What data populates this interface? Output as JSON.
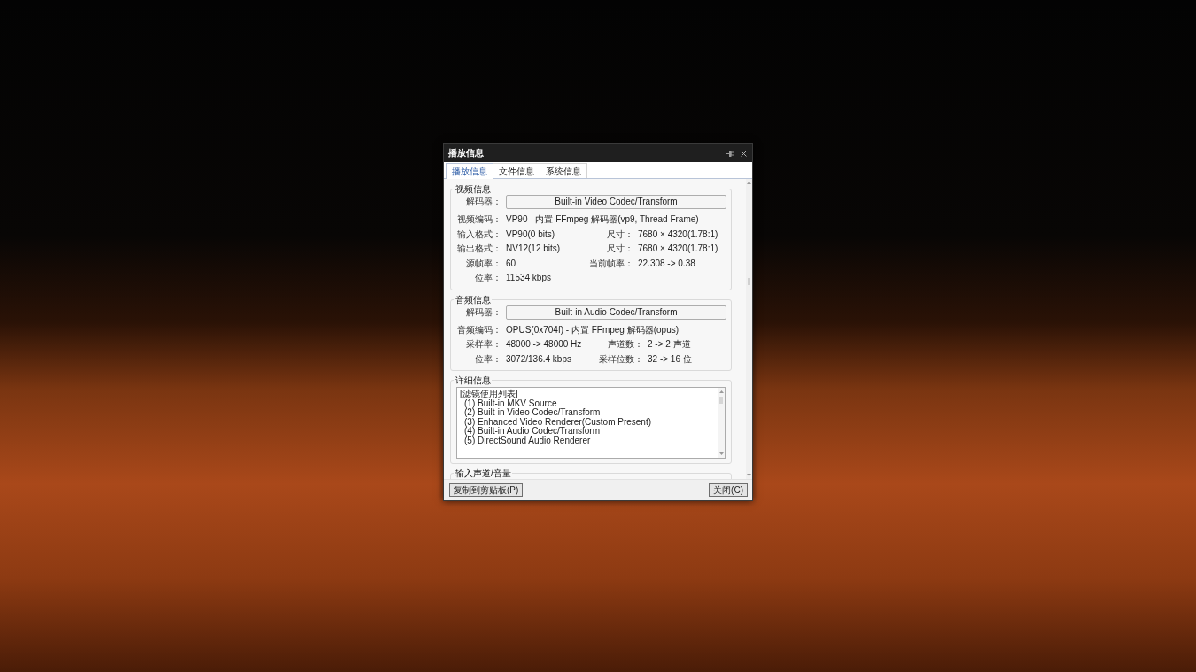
{
  "window": {
    "title": "播放信息"
  },
  "tabs": [
    {
      "label": "播放信息",
      "selected": true
    },
    {
      "label": "文件信息",
      "selected": false
    },
    {
      "label": "系统信息",
      "selected": false
    }
  ],
  "sections": [
    {
      "kind": "info",
      "title": "视频信息",
      "decoder": {
        "label": "解码器：",
        "value": "Built-in Video Codec/Transform"
      },
      "rows": [
        {
          "fields": [
            {
              "label": "视频编码：",
              "value": "VP90 - 内置 FFmpeg 解码器(vp9, Thread Frame)"
            }
          ]
        },
        {
          "fields": [
            {
              "label": "输入格式：",
              "value": "VP90(0 bits)"
            },
            {
              "label": "尺寸：",
              "value": "7680 × 4320(1.78:1)"
            }
          ]
        },
        {
          "fields": [
            {
              "label": "输出格式：",
              "value": "NV12(12 bits)"
            },
            {
              "label": "尺寸：",
              "value": "7680 × 4320(1.78:1)"
            }
          ]
        },
        {
          "fields": [
            {
              "label": "源帧率：",
              "value": "60"
            },
            {
              "label": "当前帧率：",
              "value": "22.308 -> 0.38"
            }
          ]
        },
        {
          "fields": [
            {
              "label": "位率：",
              "value": "11534 kbps"
            }
          ]
        }
      ]
    },
    {
      "kind": "info",
      "title": "音频信息",
      "decoder": {
        "label": "解码器：",
        "value": "Built-in Audio Codec/Transform"
      },
      "rows": [
        {
          "fields": [
            {
              "label": "音频编码：",
              "value": "OPUS(0x704f) - 内置 FFmpeg 解码器(opus)"
            }
          ]
        },
        {
          "fields": [
            {
              "label": "采样率：",
              "value": "48000 -> 48000 Hz"
            },
            {
              "label": "声道数：",
              "value": "2 -> 2 声道"
            }
          ]
        },
        {
          "fields": [
            {
              "label": "位率：",
              "value": "3072/136.4 kbps"
            },
            {
              "label": "采样位数：",
              "value": "32 -> 16 位"
            }
          ]
        }
      ]
    },
    {
      "kind": "list",
      "title": "详细信息",
      "list": {
        "heading": "[滤镜使用列表]",
        "items": [
          "(1) Built-in MKV Source",
          "(2) Built-in Video Codec/Transform",
          "(3) Enhanced Video Renderer(Custom Present)",
          "(4) Built-in Audio Codec/Transform",
          "(5) DirectSound Audio Renderer"
        ]
      }
    },
    {
      "kind": "info",
      "title": "输入声道/音量"
    }
  ],
  "buttons": [
    {
      "label": "复制到剪贴板(P)"
    },
    {
      "label": "关闭(C)"
    }
  ]
}
